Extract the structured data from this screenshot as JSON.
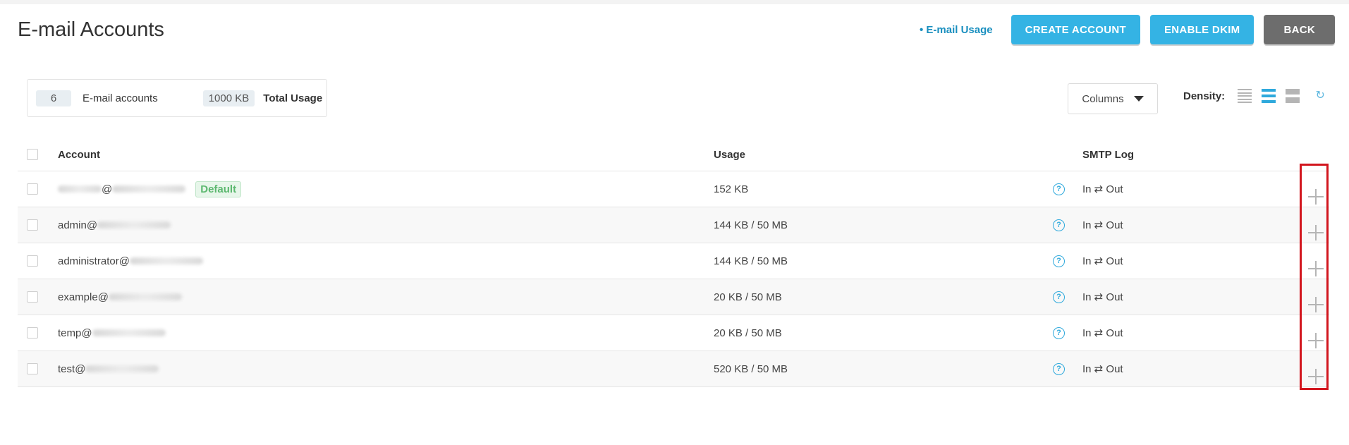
{
  "page": {
    "title": "E-mail Accounts",
    "usage_link": "• E-mail Usage"
  },
  "header_buttons": {
    "create": "CREATE ACCOUNT",
    "dkim": "ENABLE DKIM",
    "back": "BACK"
  },
  "summary": {
    "count": "6",
    "count_label": "E-mail accounts",
    "usage": "1000 KB",
    "usage_label": "Total Usage"
  },
  "toolbar": {
    "columns_label": "Columns",
    "density_label": "Density:"
  },
  "table": {
    "headers": {
      "account": "Account",
      "usage": "Usage",
      "smtp": "SMTP Log"
    },
    "default_badge": "Default",
    "rows": [
      {
        "account_prefix": "",
        "at": "@",
        "usage": "152 KB",
        "smtp": "In ⇄ Out",
        "default": true
      },
      {
        "account_prefix": "admin",
        "at": "@",
        "usage": "144 KB / 50 MB",
        "smtp": "In ⇄ Out"
      },
      {
        "account_prefix": "administrator",
        "at": "@",
        "usage": "144 KB / 50 MB",
        "smtp": "In ⇄ Out"
      },
      {
        "account_prefix": "example",
        "at": "@",
        "usage": "20 KB / 50 MB",
        "smtp": "In ⇄ Out"
      },
      {
        "account_prefix": "temp",
        "at": "@",
        "usage": "20 KB / 50 MB",
        "smtp": "In ⇄ Out"
      },
      {
        "account_prefix": "test",
        "at": "@",
        "usage": "520 KB / 50 MB",
        "smtp": "In ⇄ Out"
      }
    ]
  },
  "colors": {
    "accent": "#34b3e4",
    "back_button": "#6d6d6d",
    "link": "#1a8fbf",
    "highlight": "#d2161e",
    "default_badge": "#5cb86f"
  },
  "icons": [
    "help-icon",
    "plus-icon",
    "caret-down-icon",
    "refresh-icon",
    "density-compact-icon",
    "density-normal-icon",
    "density-wide-icon"
  ]
}
